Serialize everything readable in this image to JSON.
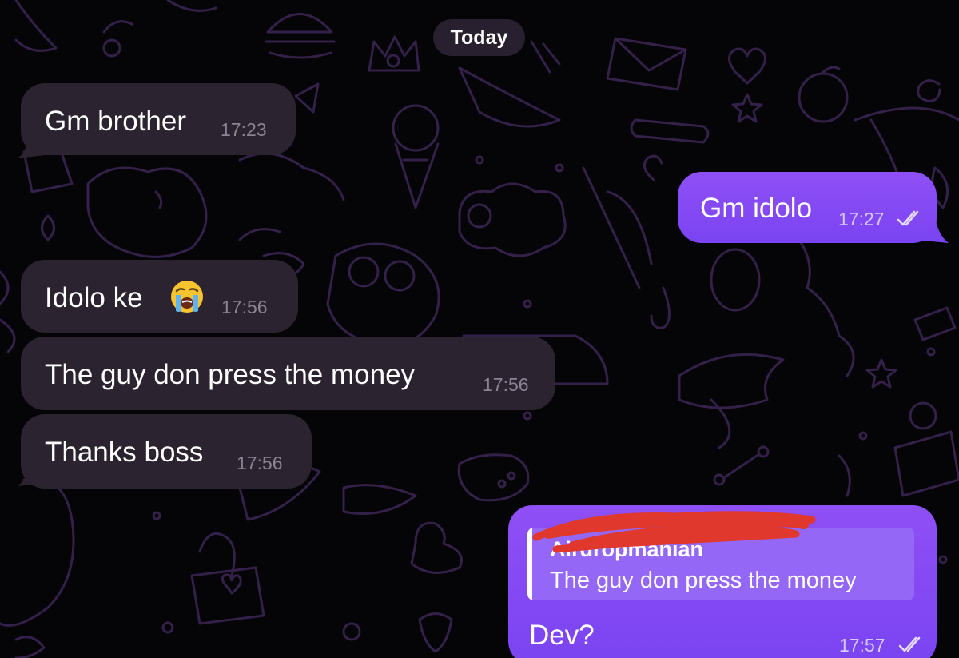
{
  "chat": {
    "date_separator": "Today",
    "messages": [
      {
        "text": "Gm brother",
        "time": "17:23",
        "direction": "incoming"
      },
      {
        "text": "Gm idolo",
        "time": "17:27",
        "direction": "outgoing",
        "status": "read"
      },
      {
        "text": "Idolo ke",
        "emoji": "loudly-crying-face-emoji",
        "time": "17:56",
        "direction": "incoming"
      },
      {
        "text": "The guy don press the money",
        "time": "17:56",
        "direction": "incoming"
      },
      {
        "text": "Thanks boss",
        "time": "17:56",
        "direction": "incoming"
      },
      {
        "text": "Dev?",
        "time": "17:57",
        "direction": "outgoing",
        "status": "read",
        "reply": {
          "author": "Airdropmanian",
          "author_redacted": true,
          "text": "The guy don press the money"
        }
      }
    ]
  },
  "colors": {
    "background": "#050407",
    "incoming_bubble": "#2b2330",
    "outgoing_bubble": "#8f4ff5",
    "wallpaper_doodle": "#3a2552",
    "redaction": "#e0382c"
  }
}
